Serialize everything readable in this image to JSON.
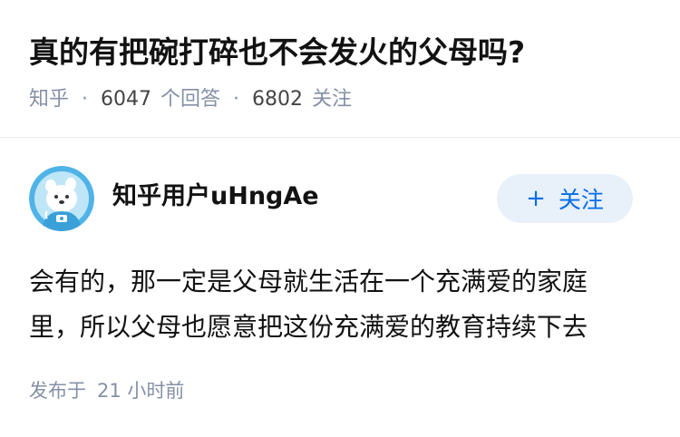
{
  "question": {
    "title": "真的有把碗打碎也不会发火的父母吗?",
    "source": "知乎",
    "answer_count": "6047",
    "answer_label": "个回答",
    "follow_count": "6802",
    "follow_label": "关注",
    "separator": "·"
  },
  "answer": {
    "author_name": "知乎用户uHngAe",
    "avatar_icon": "bear-astronaut-avatar",
    "follow_button": {
      "icon": "plus-icon",
      "plus": "+",
      "label": "关注"
    },
    "content_lines": [
      "会有的，那一定是父母就生活在一个充满爱的家庭",
      "里，所以父母也愿意把这份充满爱的教育持续下去"
    ],
    "publish_prefix": "发布于",
    "publish_time": "21 小时前"
  },
  "colors": {
    "accent": "#056de8",
    "button_bg": "#e8f0fa",
    "muted": "#8590a6",
    "text": "#121212"
  }
}
